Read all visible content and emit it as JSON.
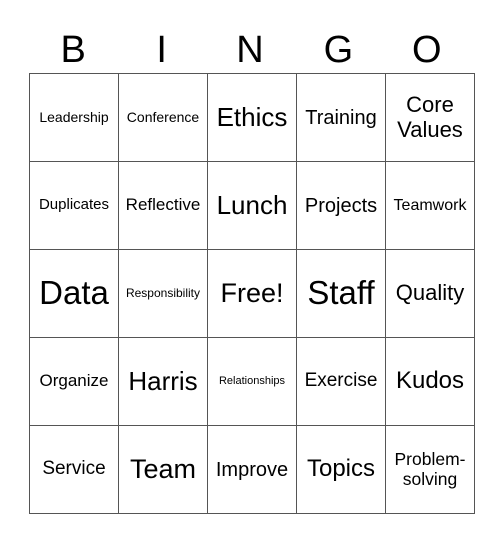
{
  "header": [
    "B",
    "I",
    "N",
    "G",
    "O"
  ],
  "rows": [
    [
      "Leadership",
      "Conference",
      "Ethics",
      "Training",
      "Core Values"
    ],
    [
      "Duplicates",
      "Reflective",
      "Lunch",
      "Projects",
      "Teamwork"
    ],
    [
      "Data",
      "Responsibility",
      "Free!",
      "Staff",
      "Quality"
    ],
    [
      "Organize",
      "Harris",
      "Relationships",
      "Exercise",
      "Kudos"
    ],
    [
      "Service",
      "Team",
      "Improve",
      "Topics",
      "Problem-solving"
    ]
  ],
  "cell_display": {
    "core_values_line1": "Core",
    "core_values_line2": "Values",
    "problem_solving_line1": "Problem-",
    "problem_solving_line2": "solving"
  }
}
